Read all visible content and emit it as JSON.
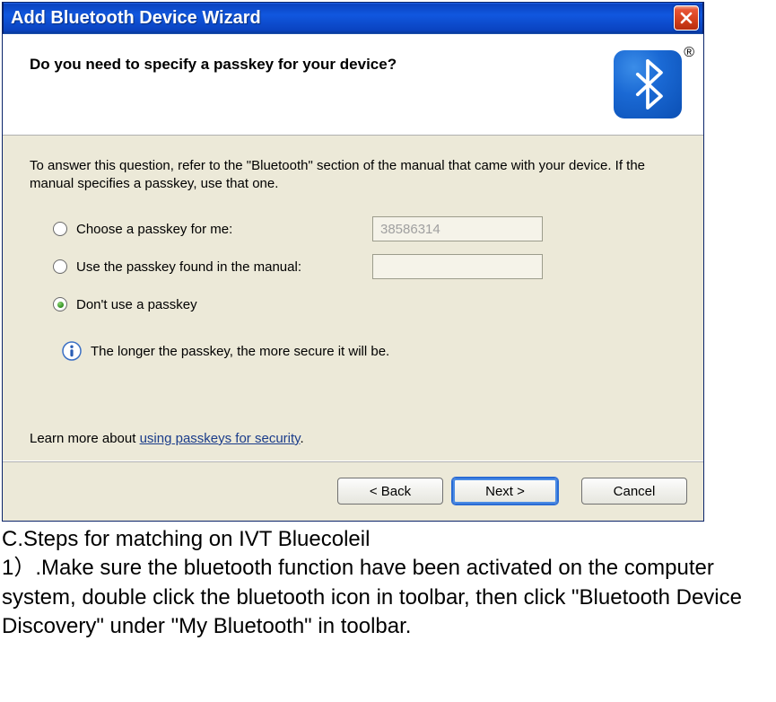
{
  "window": {
    "title": "Add Bluetooth Device Wizard"
  },
  "header": {
    "question": "Do you need to specify a passkey for your device?"
  },
  "body": {
    "intro": "To answer this question, refer to the \"Bluetooth\" section of the manual that came with your device. If the manual specifies a passkey, use that one.",
    "options": {
      "choose": "Choose a passkey for me:",
      "manual": "Use the passkey found in the manual:",
      "none": "Don't use a passkey"
    },
    "generated_passkey": "38586314",
    "info": "The longer the passkey, the more secure it will be.",
    "learn_prefix": "Learn more about ",
    "learn_link": "using passkeys for security",
    "learn_suffix": "."
  },
  "footer": {
    "back": "< Back",
    "next": "Next >",
    "cancel": "Cancel"
  },
  "doc": {
    "heading": "C.Steps for matching on IVT Bluecoleil",
    "step1": " 1）.Make sure the bluetooth function have been activated on the computer system, double click the bluetooth icon in toolbar, then click \"Bluetooth Device Discovery\" under \"My Bluetooth\" in toolbar."
  }
}
